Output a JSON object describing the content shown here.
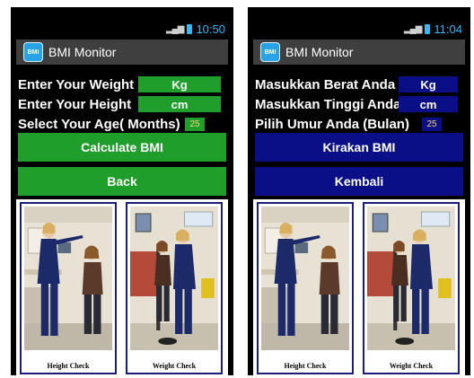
{
  "screens": [
    {
      "time": "10:50",
      "app_title": "BMI Monitor",
      "app_icon_text": "BMI",
      "weight_label": "Enter Your Weight",
      "weight_unit": "Kg",
      "height_label": "Enter Your Height",
      "height_unit": "cm",
      "age_label": "Select Your Age( Months)",
      "age_value": "25",
      "calc_button": "Calculate BMI",
      "back_button": "Back",
      "caption_height": "Height Check",
      "caption_weight": "Weight Check"
    },
    {
      "time": "11:04",
      "app_title": "BMI Monitor",
      "app_icon_text": "BMI",
      "weight_label": "Masukkan Berat Anda",
      "weight_unit": "Kg",
      "height_label": "Masukkan Tinggi Anda",
      "height_unit": "cm",
      "age_label": "Pilih Umur Anda (Bulan)",
      "age_value": "25",
      "calc_button": "Kirakan BMI",
      "back_button": "Kembali",
      "caption_height": "Height Check",
      "caption_weight": "Weight Check"
    }
  ],
  "icons": {
    "signal": "signal-icon",
    "battery": "battery-icon",
    "app": "bmi-app-icon"
  },
  "colors": {
    "green_button": "#1f9e2c",
    "blue_button": "#0a0f88",
    "title_bar": "#3f3f3f",
    "status_blue": "#39b7f2"
  }
}
